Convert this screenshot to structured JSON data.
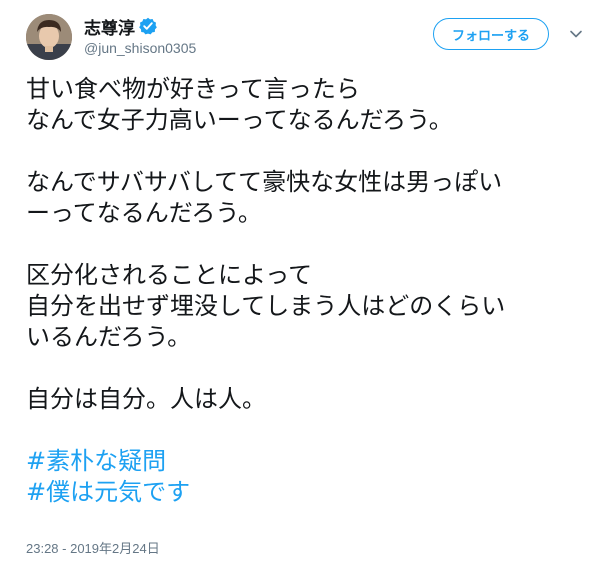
{
  "author": {
    "display_name": "志尊淳",
    "handle": "@jun_shison0305",
    "verified": true,
    "avatar_icon": "profile-photo"
  },
  "actions": {
    "follow_label": "フォローする",
    "more_icon": "chevron-down-icon"
  },
  "tweet": {
    "paragraphs": [
      [
        "甘い食べ物が好きって言ったら",
        "なんで女子力高いーってなるんだろう。"
      ],
      [
        "なんでサバサバしてて豪快な女性は男っぽい",
        "ーってなるんだろう。"
      ],
      [
        "区分化されることによって",
        "自分を出せず埋没してしまう人はどのくらい",
        "いるんだろう。"
      ],
      [
        "自分は自分。人は人。"
      ]
    ],
    "hashtags": [
      "#素朴な疑問",
      "#僕は元気です"
    ],
    "timestamp": "23:28 - 2019年2月24日"
  },
  "colors": {
    "accent": "#1da1f2",
    "text": "#14171a",
    "muted": "#657786"
  }
}
